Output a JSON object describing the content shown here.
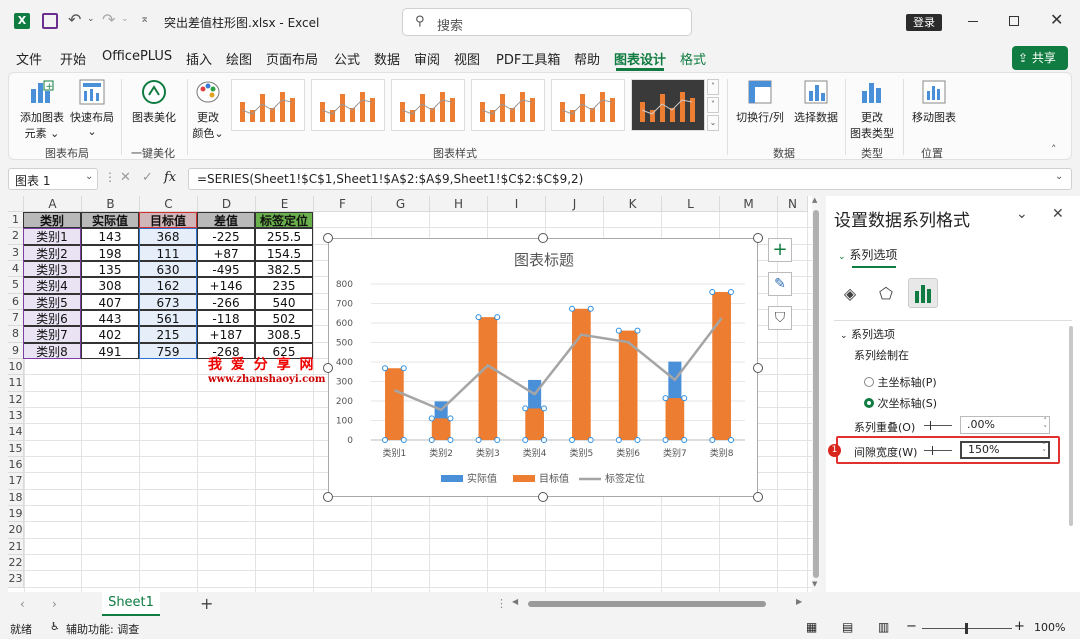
{
  "titlebar": {
    "filename": "突出差值柱形图.xlsx",
    "app": "Excel",
    "search_placeholder": "搜索",
    "login": "登录"
  },
  "menu": [
    "文件",
    "开始",
    "OfficePLUS",
    "插入",
    "绘图",
    "页面布局",
    "公式",
    "数据",
    "审阅",
    "视图",
    "PDF工具箱",
    "帮助",
    "图表设计",
    "格式"
  ],
  "share": "共享",
  "ribbon": {
    "add_element": "添加图表",
    "add_element2": "元素",
    "quick_layout": "快速布局",
    "beautify": "图表美化",
    "change_color": "更改",
    "change_color2": "颜色",
    "switch_rowcol": "切换行/列",
    "select_data": "选择数据",
    "change_type": "更改",
    "change_type2": "图表类型",
    "move_chart": "移动图表",
    "groups": {
      "layout": "图表布局",
      "beautify": "一键美化",
      "styles": "图表样式",
      "data": "数据",
      "type": "类型",
      "location": "位置"
    }
  },
  "formula": {
    "namebox": "图表 1",
    "fx": "fx",
    "text": "=SERIES(Sheet1!$C$1,Sheet1!$A$2:$A$9,Sheet1!$C$2:$C$9,2)"
  },
  "sheet": {
    "columns": [
      "A",
      "B",
      "C",
      "D",
      "E",
      "F",
      "G",
      "H",
      "I",
      "J",
      "K",
      "L",
      "M",
      "N"
    ],
    "rows": [
      "1",
      "2",
      "3",
      "4",
      "5",
      "6",
      "7",
      "8",
      "9",
      "10",
      "11",
      "12",
      "13",
      "14",
      "15",
      "16",
      "17",
      "18",
      "19",
      "20",
      "21",
      "22",
      "23"
    ],
    "headers": [
      "类别",
      "实际值",
      "目标值",
      "差值",
      "标签定位"
    ],
    "data": [
      [
        "类别1",
        "143",
        "368",
        "-225",
        "255.5"
      ],
      [
        "类别2",
        "198",
        "111",
        "+87",
        "154.5"
      ],
      [
        "类别3",
        "135",
        "630",
        "-495",
        "382.5"
      ],
      [
        "类别4",
        "308",
        "162",
        "+146",
        "235"
      ],
      [
        "类别5",
        "407",
        "673",
        "-266",
        "540"
      ],
      [
        "类别6",
        "443",
        "561",
        "-118",
        "502"
      ],
      [
        "类别7",
        "402",
        "215",
        "+187",
        "308.5"
      ],
      [
        "类别8",
        "491",
        "759",
        "-268",
        "625"
      ]
    ],
    "watermark": "我 爱 分 享 网",
    "watermark_url": "www.zhanshaoyi.com"
  },
  "chart_data": {
    "type": "bar",
    "title": "图表标题",
    "categories": [
      "类别1",
      "类别2",
      "类别3",
      "类别4",
      "类别5",
      "类别6",
      "类别7",
      "类别8"
    ],
    "series": [
      {
        "name": "实际值",
        "values": [
          143,
          198,
          135,
          308,
          407,
          443,
          402,
          491
        ],
        "color": "#4a90d9"
      },
      {
        "name": "目标值",
        "values": [
          368,
          111,
          630,
          162,
          673,
          561,
          215,
          759
        ],
        "color": "#ed7d31"
      },
      {
        "name": "标签定位",
        "type": "line",
        "values": [
          255.5,
          154.5,
          382.5,
          235,
          540,
          502,
          308.5,
          625
        ],
        "color": "#a5a5a5"
      }
    ],
    "ylim": [
      0,
      800
    ],
    "yticks": [
      "0",
      "100",
      "200",
      "300",
      "400",
      "500",
      "600",
      "700",
      "800"
    ],
    "legend": "bottom"
  },
  "pane": {
    "title": "设置数据系列格式",
    "tab": "系列选项",
    "section": "系列选项",
    "plot_on": "系列绘制在",
    "primary": "主坐标轴(P)",
    "secondary": "次坐标轴(S)",
    "overlap_label": "系列重叠(O)",
    "overlap_value": ".00%",
    "gap_label": "间隙宽度(W)",
    "gap_value": "150%",
    "badge": "1"
  },
  "tabs": {
    "sheet": "Sheet1"
  },
  "status": {
    "ready": "就绪",
    "accessibility": "辅助功能: 调查",
    "zoom": "100%"
  }
}
